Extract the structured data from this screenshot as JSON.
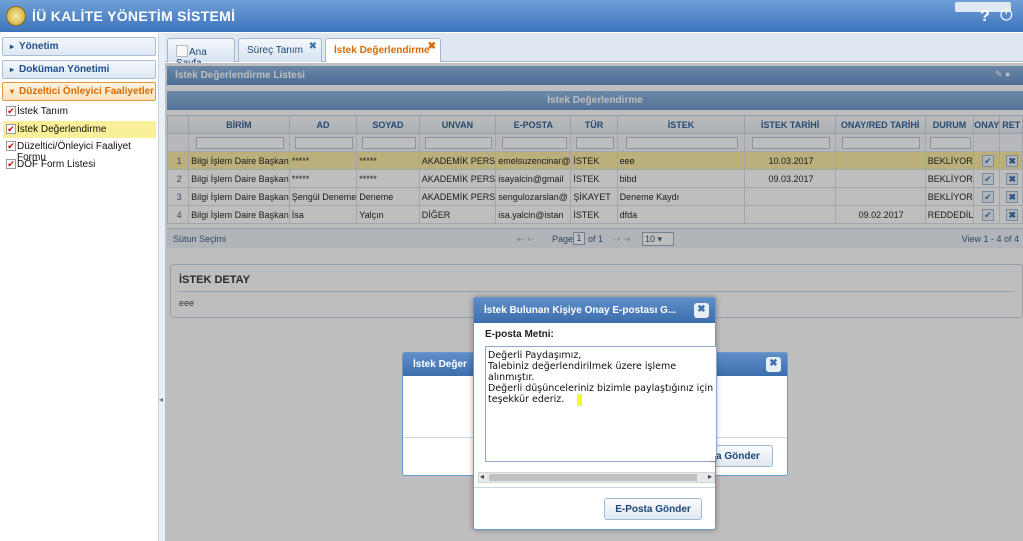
{
  "app": {
    "title": "İÜ KALİTE YÖNETİM SİSTEMİ",
    "help": "?",
    "power": "⏻"
  },
  "sidebar": {
    "accordions": [
      {
        "label": "Yönetim"
      },
      {
        "label": "Doküman Yönetimi"
      },
      {
        "label": "Düzeltici Önleyici Faaliyetler"
      }
    ],
    "items": [
      {
        "label": "İstek Tanım"
      },
      {
        "label": "İstek Değerlendirme"
      },
      {
        "label": "Düzeltici/Önleyici Faaliyet Formu"
      },
      {
        "label": "DÖF Form Listesi"
      }
    ]
  },
  "tabs": [
    {
      "label": "Ana Sayfa"
    },
    {
      "label": "Süreç Tanım"
    },
    {
      "label": "İstek Değerlendirme"
    }
  ],
  "list": {
    "header": "İstek Değerlendirme Listesi",
    "grid_title": "İstek Değerlendirme",
    "columns": [
      "",
      "BİRİM",
      "AD",
      "SOYAD",
      "UNVAN",
      "E-POSTA",
      "TÜR",
      "İSTEK",
      "İSTEK TARİHİ",
      "ONAY/RED TARİHİ",
      "DURUM",
      "ONAY",
      "RET"
    ],
    "rows": [
      {
        "n": "1",
        "birim": "Bilgi İşlem Daire Başkan",
        "ad": "*****",
        "soyad": "*****",
        "unvan": "AKADEMİK PERS",
        "eposta": "emelsuzencinar@",
        "tur": "İSTEK",
        "istek": "eee",
        "istek_tarihi": "10.03.2017",
        "onay_tarihi": "",
        "durum": "BEKLİYOR"
      },
      {
        "n": "2",
        "birim": "Bilgi İşlem Daire Başkan",
        "ad": "*****",
        "soyad": "*****",
        "unvan": "AKADEMİK PERS",
        "eposta": "isayalcin@gmail",
        "tur": "İSTEK",
        "istek": "bibd",
        "istek_tarihi": "09.03.2017",
        "onay_tarihi": "",
        "durum": "BEKLİYOR"
      },
      {
        "n": "3",
        "birim": "Bilgi İşlem Daire Başkan",
        "ad": "Şengül Deneme",
        "soyad": "Deneme",
        "unvan": "AKADEMİK PERS",
        "eposta": "sengulozarslan@",
        "tur": "ŞİKAYET",
        "istek": "Deneme Kaydı",
        "istek_tarihi": "",
        "onay_tarihi": "",
        "durum": "BEKLİYOR"
      },
      {
        "n": "4",
        "birim": "Bilgi İşlem Daire Başkan",
        "ad": "İsa",
        "soyad": "Yalçın",
        "unvan": "DİĞER",
        "eposta": "isa.yalcin@istan",
        "tur": "İSTEK",
        "istek": "dfda",
        "istek_tarihi": "",
        "onay_tarihi": "09.02.2017",
        "durum": "REDDEDİL"
      }
    ],
    "pager": {
      "column_select": "Sütun Seçimi",
      "first_prev": "⇤  ⇠",
      "page_label": "Page",
      "page_value": "1",
      "of_label": "of 1",
      "next_last": "⇢  ⇥",
      "page_size": "10",
      "view": "View 1 - 4 of 4"
    }
  },
  "detail": {
    "title": "İSTEK DETAY",
    "text": "eee"
  },
  "back_dialog": {
    "title": "İstek Değer",
    "button": "a Gönder"
  },
  "dialog": {
    "title": "İstek Bulunan Kişiye Onay E-postası G...",
    "label": "E-posta Metni:",
    "body": "Değerli Paydaşımız,\nTalebiniz değerlendirilmek üzere işleme alınmıştır.\nDeğerli düşünceleriniz bizimle paylaştığınız için teşekkür ederiz.",
    "button": "E-Posta Gönder"
  }
}
